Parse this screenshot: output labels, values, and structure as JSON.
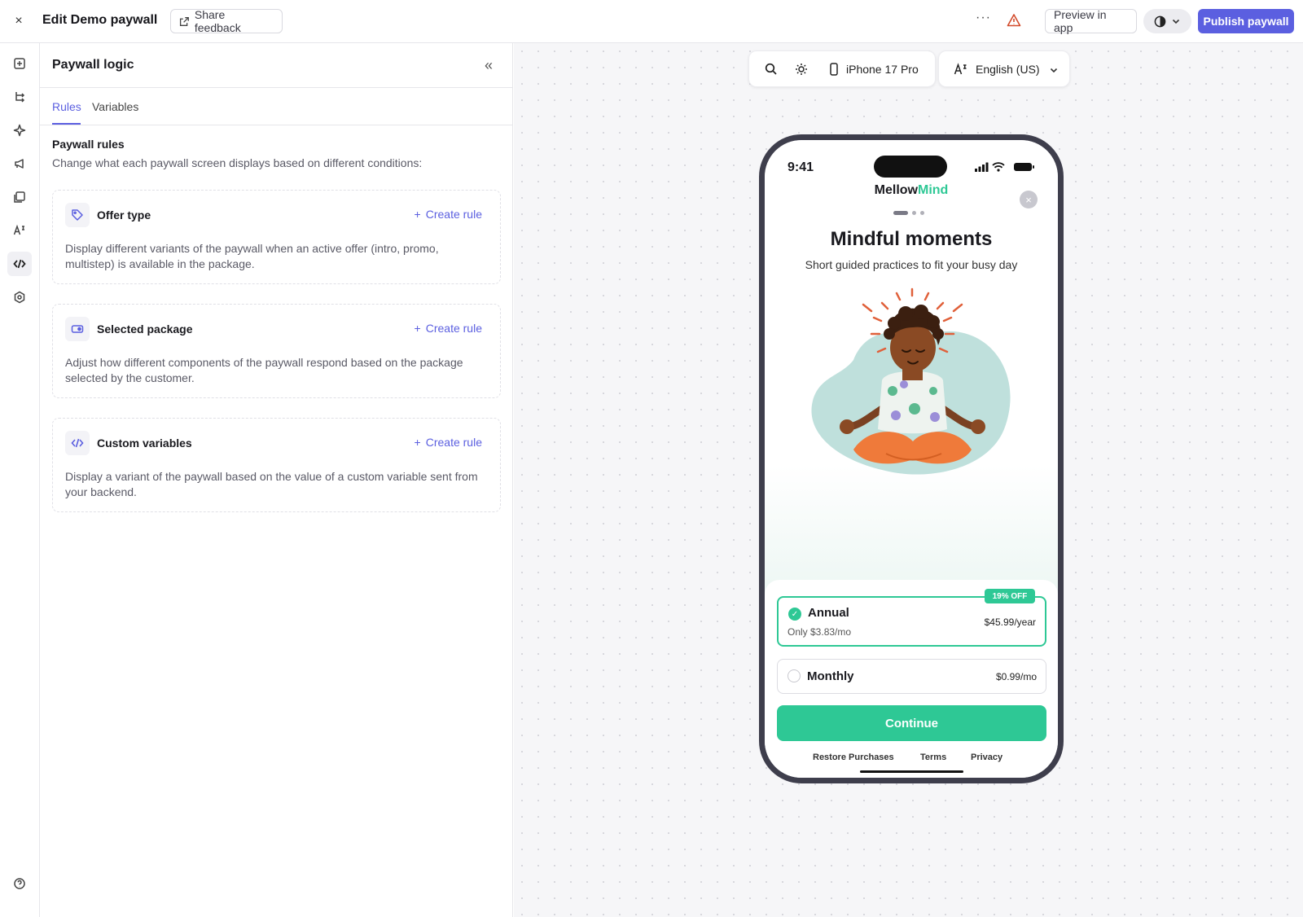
{
  "topbar": {
    "close_glyph": "×",
    "title": "Edit Demo paywall",
    "share_label": "Share feedback",
    "more_glyph": "···",
    "preview_label": "Preview in app",
    "publish_label": "Publish paywall"
  },
  "rail": {
    "items": [
      "add-component-icon",
      "layers-tree-icon",
      "sparkle-icon",
      "campaign-icon",
      "library-icon",
      "localization-icon",
      "code-icon",
      "settings-hex-icon"
    ],
    "active": "code-icon",
    "help_icon": "help-icon"
  },
  "panel": {
    "title": "Paywall logic",
    "collapse_glyph": "«",
    "tabs": [
      {
        "label": "Rules",
        "active": true
      },
      {
        "label": "Variables",
        "active": false
      }
    ],
    "rules_title": "Paywall rules",
    "rules_desc": "Change what each paywall screen displays based on different conditions:",
    "cards": [
      {
        "title": "Offer type",
        "action": "Create rule",
        "icon": "tag-icon",
        "desc": "Display different variants of the paywall when an active offer (intro, promo, multistep) is available in the package."
      },
      {
        "title": "Selected package",
        "action": "Create rule",
        "icon": "package-toggle-icon",
        "desc": "Adjust how different components of the paywall respond based on the package selected by the customer."
      },
      {
        "title": "Custom variables",
        "action": "Create rule",
        "icon": "code-icon",
        "desc": "Display a variant of the paywall based on the value of a custom variable sent from your backend."
      }
    ]
  },
  "toolbar": {
    "device": "iPhone 17 Pro",
    "language": "English (US)"
  },
  "phone": {
    "time": "9:41",
    "brand_main": "Mellow",
    "brand_accent": "Mind",
    "headline": "Mindful moments",
    "subhead": "Short guided practices to fit your busy day",
    "close_glyph": "×",
    "packages": [
      {
        "name": "Annual",
        "sub": "Only $3.83/mo",
        "price": "$45.99/year",
        "selected": true,
        "badge": "19% OFF"
      },
      {
        "name": "Monthly",
        "price": "$0.99/mo",
        "selected": false
      }
    ],
    "cta": "Continue",
    "footer": [
      "Restore Purchases",
      "Terms",
      "Privacy"
    ]
  },
  "colors": {
    "accent": "#5b5fe0",
    "brand_green": "#2ec895"
  }
}
